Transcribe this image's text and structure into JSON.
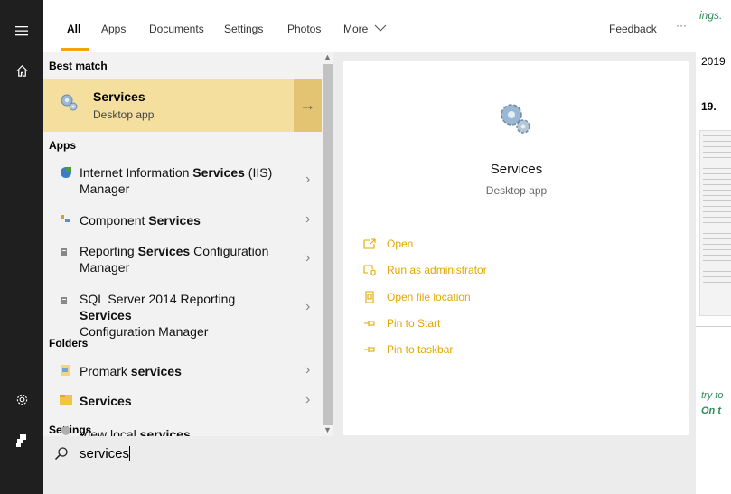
{
  "background_doc": {
    "line1": "ings.",
    "line2": "2019",
    "line3": "19.",
    "line4": "try to",
    "line5": "On t"
  },
  "rail": {
    "menu_icon": "hamburger-icon",
    "home_icon": "home-icon",
    "settings_icon": "gear-icon",
    "user_icon": "user-icon"
  },
  "tabs": [
    {
      "label": "All",
      "active": true
    },
    {
      "label": "Apps"
    },
    {
      "label": "Documents"
    },
    {
      "label": "Settings"
    },
    {
      "label": "Photos"
    },
    {
      "label": "More"
    }
  ],
  "toolbar": {
    "feedback": "Feedback",
    "more_options": "···"
  },
  "sections": {
    "best_match": "Best match",
    "apps": "Apps",
    "folders": "Folders",
    "settings": "Settings"
  },
  "best_match": {
    "title": "Services",
    "subtitle": "Desktop app"
  },
  "apps": [
    {
      "pre": "Internet Information ",
      "bold": "Services",
      "post": " (IIS)",
      "line2": "Manager"
    },
    {
      "pre": "Component ",
      "bold": "Services",
      "post": "",
      "line2": ""
    },
    {
      "pre": "Reporting ",
      "bold": "Services",
      "post": " Configuration",
      "line2": "Manager"
    },
    {
      "pre": "SQL Server 2014 Reporting ",
      "bold": "Services",
      "post": "",
      "line2": "Configuration Manager"
    }
  ],
  "folders": [
    {
      "pre": "Promark ",
      "bold": "services",
      "post": ""
    },
    {
      "pre": "",
      "bold": "Services",
      "post": ""
    }
  ],
  "settings_items": [
    {
      "pre": "View local ",
      "bold": "services",
      "post": ""
    }
  ],
  "preview": {
    "title": "Services",
    "subtitle": "Desktop app",
    "actions": [
      {
        "label": "Open",
        "icon": "open-icon"
      },
      {
        "label": "Run as administrator",
        "icon": "shield-icon"
      },
      {
        "label": "Open file location",
        "icon": "file-location-icon"
      },
      {
        "label": "Pin to Start",
        "icon": "pin-icon"
      },
      {
        "label": "Pin to taskbar",
        "icon": "pin-icon"
      }
    ]
  },
  "search": {
    "query": "services"
  },
  "colors": {
    "accent": "#e2a700",
    "best_match_bg": "#f5df9f",
    "rail_bg": "#1f1f1f"
  }
}
